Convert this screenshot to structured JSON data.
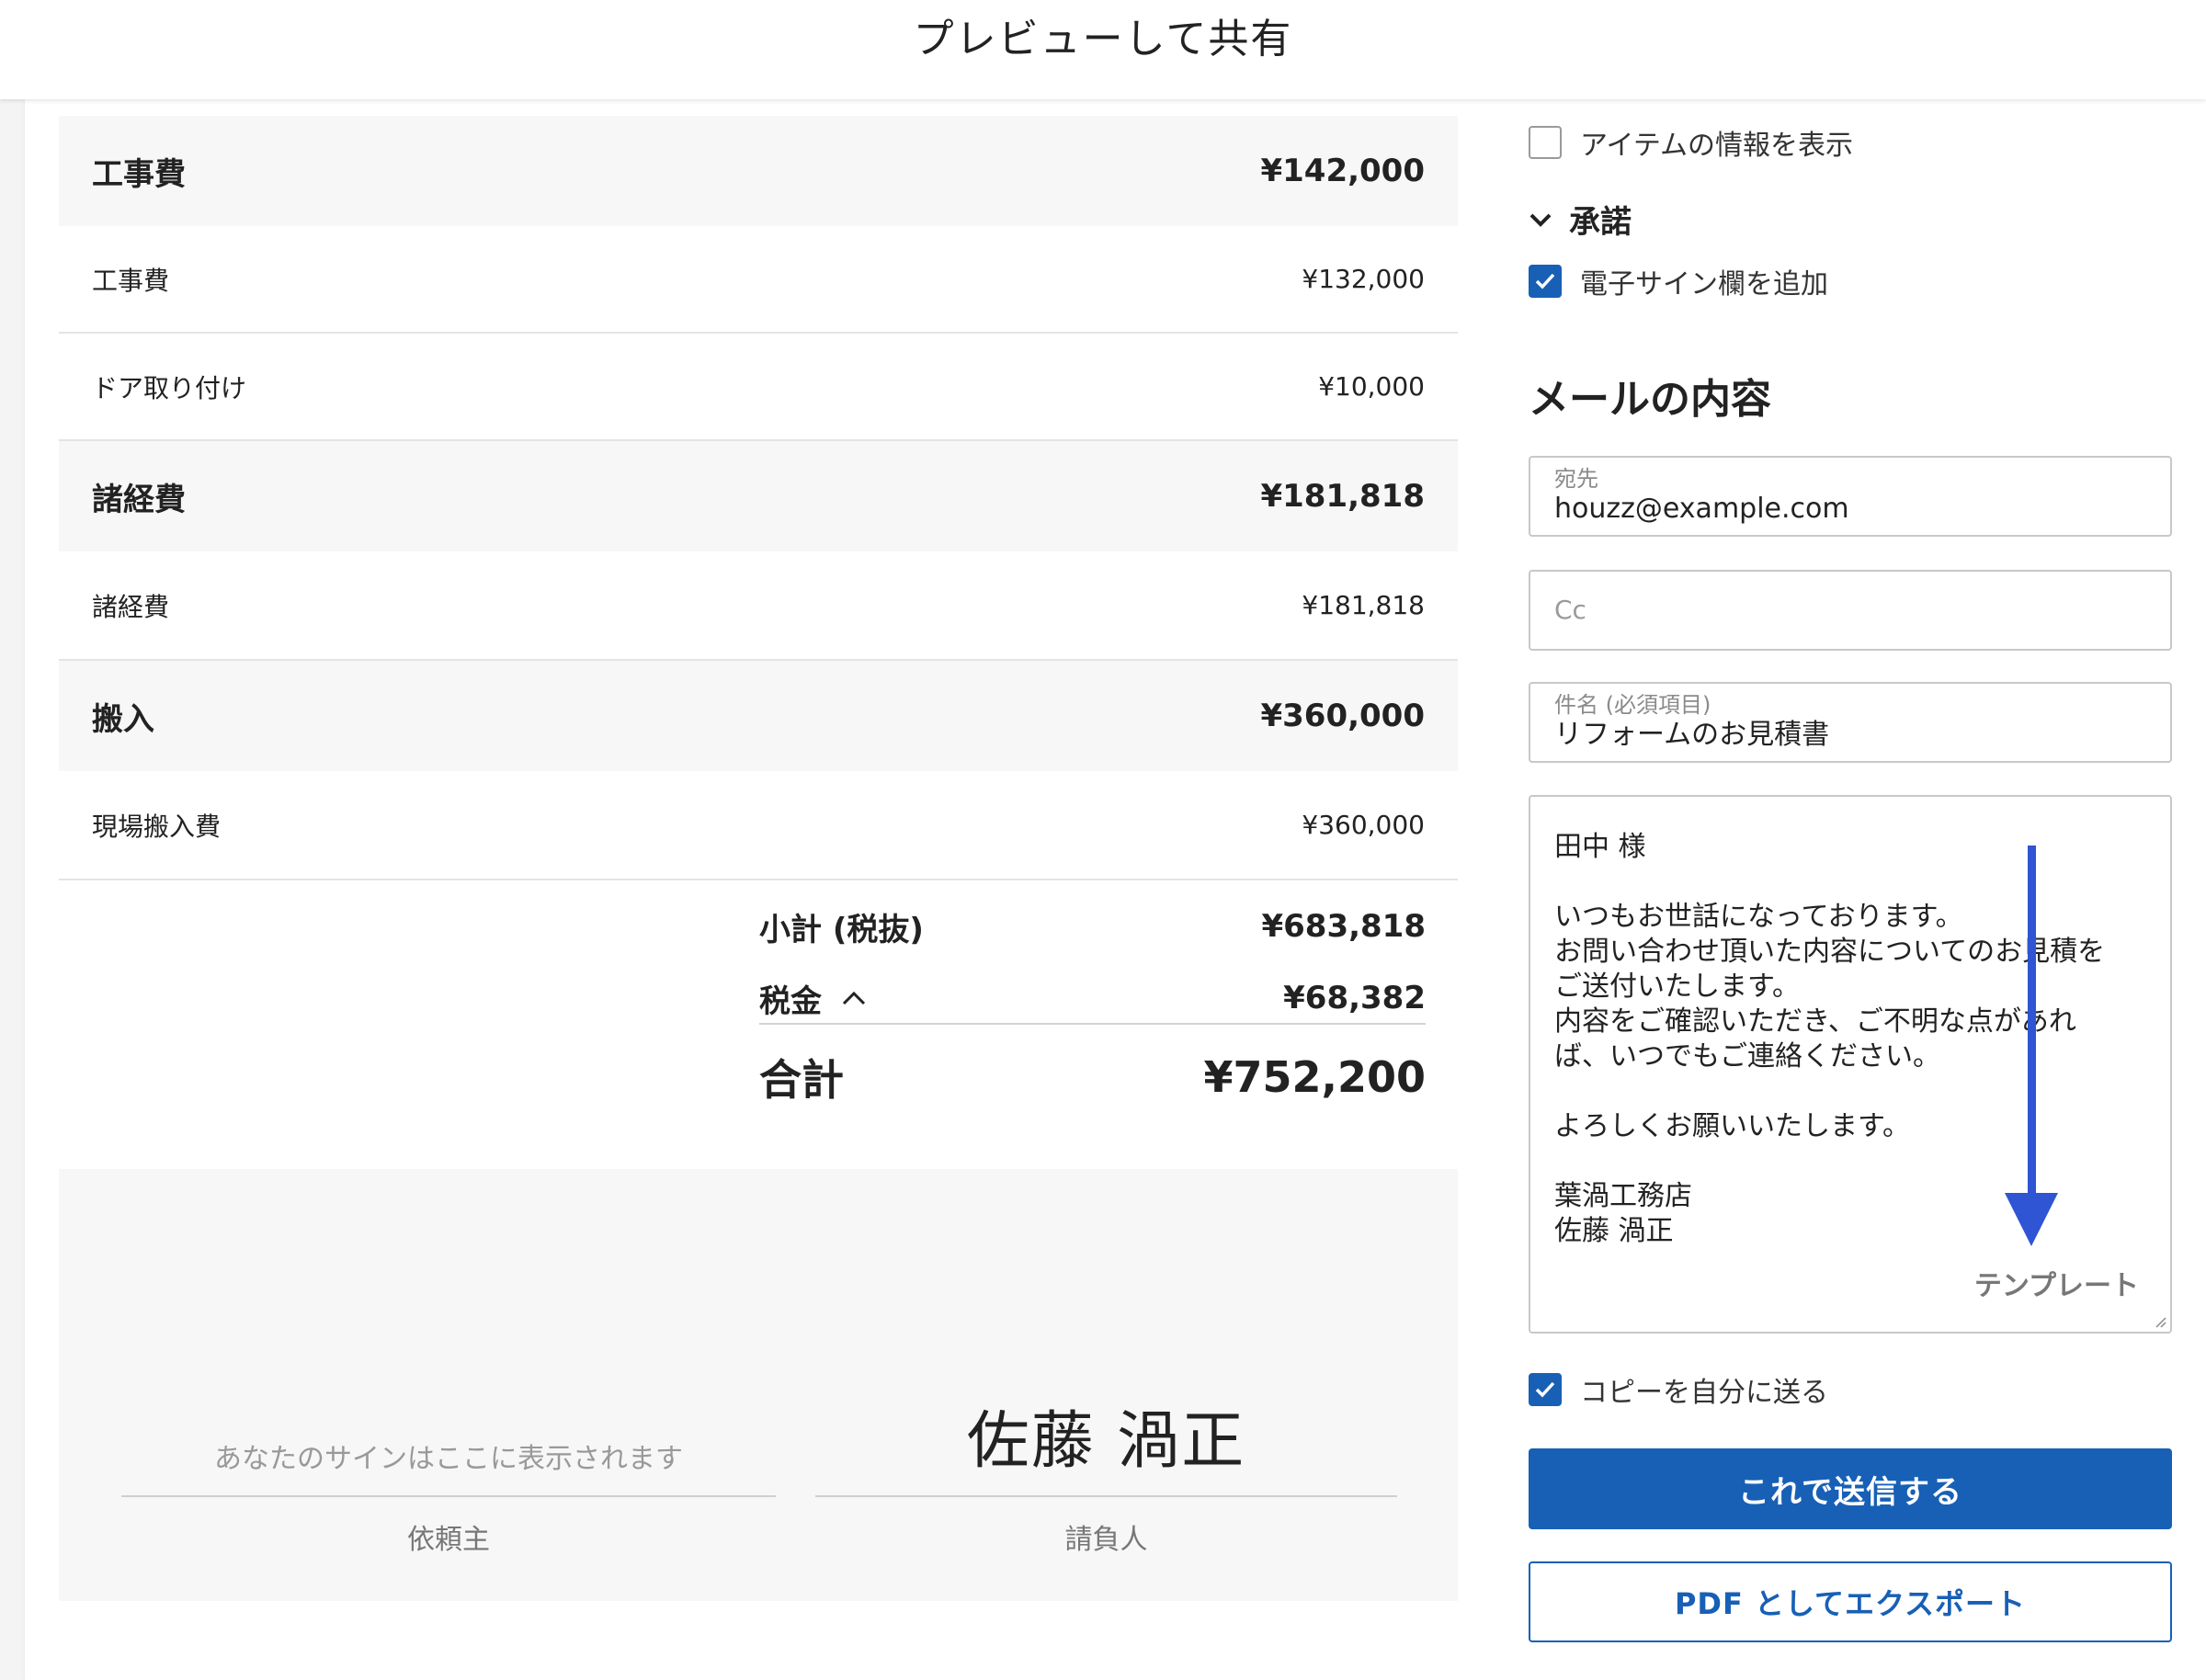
{
  "header": {
    "title": "プレビューして共有"
  },
  "estimate": {
    "groups": [
      {
        "name": "工事費",
        "total": "¥142,000",
        "items": [
          {
            "name": "工事費",
            "amount": "¥132,000"
          },
          {
            "name": "ドア取り付け",
            "amount": "¥10,000"
          }
        ]
      },
      {
        "name": "諸経費",
        "total": "¥181,818",
        "items": [
          {
            "name": "諸経費",
            "amount": "¥181,818"
          }
        ]
      },
      {
        "name": "搬入",
        "total": "¥360,000",
        "items": [
          {
            "name": "現場搬入費",
            "amount": "¥360,000"
          }
        ]
      }
    ],
    "subtotal": {
      "label": "小計 (税抜)",
      "value": "¥683,818"
    },
    "tax": {
      "label": "税金",
      "value": "¥68,382"
    },
    "total": {
      "label": "合計",
      "value": "¥752,200"
    }
  },
  "signature": {
    "client_placeholder": "あなたのサインはここに表示されます",
    "client_role": "依頼主",
    "contractor_name": "佐藤 渦正",
    "contractor_role": "請負人"
  },
  "options": {
    "show_item_info_label": "アイテムの情報を表示",
    "show_item_info_checked": false,
    "approval_section": "承諾",
    "add_esign_label": "電子サイン欄を追加",
    "add_esign_checked": true
  },
  "mail": {
    "section_title": "メールの内容",
    "to": {
      "label": "宛先",
      "value": "houzz@example.com"
    },
    "cc": {
      "placeholder": "Cc"
    },
    "subject": {
      "label": "件名 (必須項目)",
      "value": "リフォームのお見積書"
    },
    "body": {
      "greeting": "田中 様",
      "p1_l1": "いつもお世話になっております。",
      "p1_l2": "お問い合わせ頂いた内容についてのお見積を",
      "p1_l3": "ご送付いたします。",
      "p1_l4": "内容をご確認いただき、ご不明な点があれ",
      "p1_l5": "ば、いつでもご連絡ください。",
      "closing": "よろしくお願いいたします。",
      "sig_company": "葉渦工務店",
      "sig_name": "佐藤 渦正"
    },
    "template_link": "テンプレート",
    "copy_to_self_label": "コピーを自分に送る",
    "copy_to_self_checked": true
  },
  "actions": {
    "send_label": "これで送信する",
    "export_pdf_label": "PDF としてエクスポート"
  },
  "colors": {
    "primary": "#1760b6",
    "annotation_arrow": "#2f55d4"
  }
}
